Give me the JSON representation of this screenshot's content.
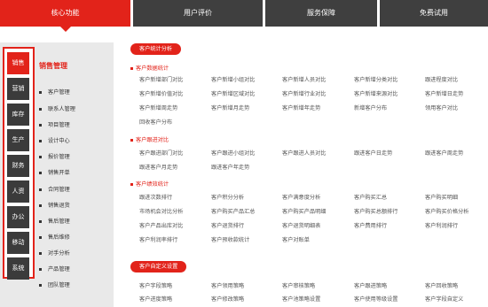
{
  "top_tabs": [
    {
      "label": "核心功能"
    },
    {
      "label": "用户评价"
    },
    {
      "label": "服务保障"
    },
    {
      "label": "免费试用"
    }
  ],
  "side_tabs": [
    {
      "label": "销售"
    },
    {
      "label": "营销"
    },
    {
      "label": "库存"
    },
    {
      "label": "生产"
    },
    {
      "label": "财务"
    },
    {
      "label": "人资"
    },
    {
      "label": "办公"
    },
    {
      "label": "移动"
    },
    {
      "label": "系统"
    }
  ],
  "menu": {
    "title": "销售管理",
    "items": [
      "客户管理",
      "联系人管理",
      "项目管理",
      "设计中心",
      "报价管理",
      "销售开单",
      "合同管理",
      "销售退货",
      "售后管理",
      "售后维修",
      "对手分析",
      "产品管理",
      "团队管理"
    ]
  },
  "main": {
    "pill_analysis": "客户统计分析",
    "sections": [
      {
        "title": "客户数据统计",
        "rows": [
          [
            "客户新增部门对比",
            "客户新增小组对比",
            "客户新增人员对比",
            "客户新增分类对比",
            "跟进程度对比"
          ],
          [
            "客户新增价值对比",
            "客户新增区域对比",
            "客户新增行业对比",
            "客户新增来源对比",
            "客户新增日走势"
          ],
          [
            "客户新增周走势",
            "客户新增月走势",
            "客户新增年走势",
            "新增客户分布",
            "领用客户对比"
          ],
          [
            "回收客户分布"
          ]
        ]
      },
      {
        "title": "客户跟进对比",
        "rows": [
          [
            "客户跟进部门对比",
            "客户跟进小组对比",
            "客户跟进人员对比",
            "跟进客户日走势",
            "跟进客户周走势"
          ],
          [
            "跟进客户月走势",
            "跟进客户年走势"
          ]
        ]
      },
      {
        "title": "客户绩效统计",
        "rows": [
          [
            "跟进次数排行",
            "客户积分分析",
            "客户满意度分析",
            "客户购买汇总",
            "客户购买明细"
          ],
          [
            "市场机会对比分析",
            "客户购买产品汇总",
            "客户购买产品明细",
            "客户购买总额排行",
            "客户购买价格分析"
          ],
          [
            "客户产品出库对比",
            "客户退货排行",
            "客户退货明细表",
            "客户费用排行",
            "客户利润排行"
          ],
          [
            "客户利润率排行",
            "客户预收款统计",
            "客户对账单"
          ]
        ]
      }
    ],
    "pill_custom": "客户自定义设置",
    "custom_rows": [
      [
        "客户字段策略",
        "客户领用策略",
        "客户审核策略",
        "客户跟进策略",
        "客户回收策略"
      ],
      [
        "客户进度策略",
        "客户修改策略",
        "客户池策略设置",
        "客户使用等级设置",
        "客户字段自定义"
      ]
    ]
  }
}
